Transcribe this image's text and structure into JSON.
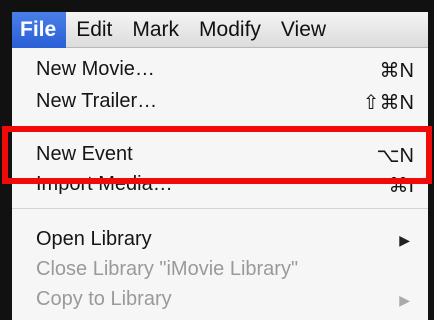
{
  "menubar": {
    "items": [
      "File",
      "Edit",
      "Mark",
      "Modify",
      "View"
    ]
  },
  "menu": {
    "items": [
      {
        "label": "New Movie…",
        "shortcut": "⌘N"
      },
      {
        "label": "New Trailer…",
        "shortcut": "⇧⌘N"
      },
      {
        "label": "New Event",
        "shortcut": "⌥N"
      },
      {
        "label": "Import Media…",
        "shortcut": "⌘I"
      },
      {
        "label": "Open Library",
        "shortcut": "▶"
      },
      {
        "label": "Close Library \"iMovie Library\"",
        "shortcut": ""
      },
      {
        "label": "Copy to Library",
        "shortcut": "▶"
      }
    ]
  },
  "colors": {
    "active_menu": "#3467dc",
    "highlight_box": "#f00a0a"
  }
}
